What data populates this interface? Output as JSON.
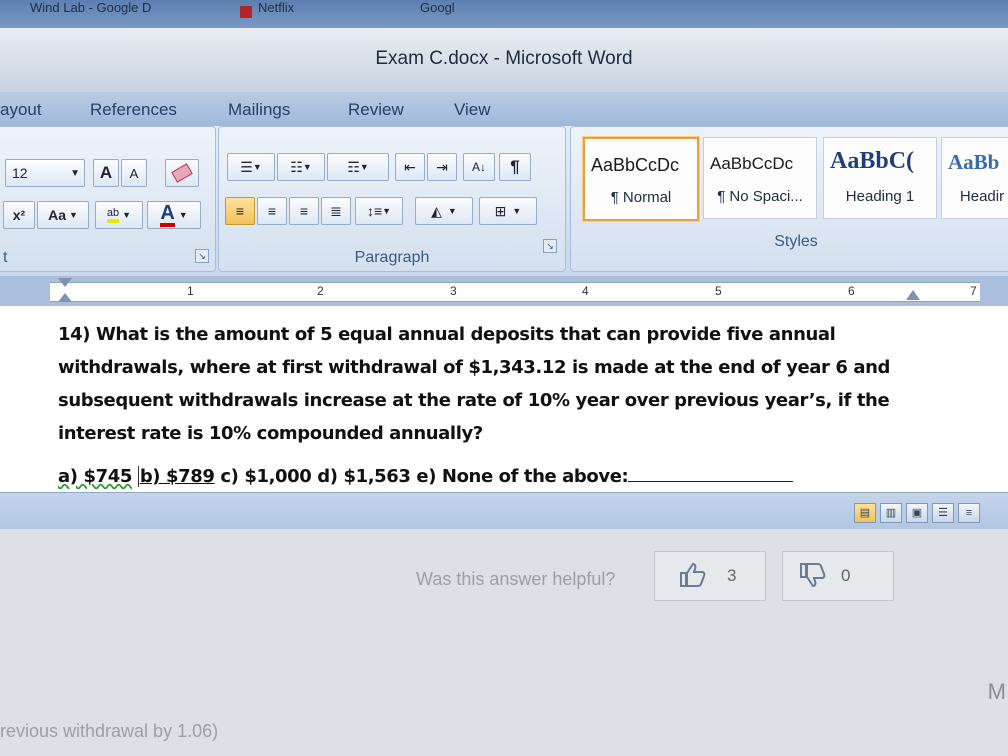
{
  "browser": {
    "tabs": [
      "Wind Lab - Google D",
      "Netflix",
      "Googl"
    ]
  },
  "window": {
    "title": "Exam C.docx - Microsoft Word"
  },
  "ribbon": {
    "tabs": [
      "ayout",
      "References",
      "Mailings",
      "Review",
      "View"
    ],
    "font": {
      "size": "12",
      "grow_label": "A",
      "shrink_label": "A",
      "change_case_label": "Aa",
      "superscript_label": "x²",
      "highlight_label": "ab",
      "font_color_label": "A",
      "group_label": "t"
    },
    "paragraph": {
      "group_label": "Paragraph"
    },
    "styles": {
      "group_label": "Styles",
      "items": [
        {
          "sample": "AaBbCcDc",
          "name": "¶ Normal",
          "selected": true
        },
        {
          "sample": "AaBbCcDc",
          "name": "¶ No Spaci...",
          "selected": false
        },
        {
          "sample": "AaBbC(",
          "name": "Heading 1",
          "selected": false
        },
        {
          "sample": "AaBb",
          "name": "Headir",
          "selected": false
        }
      ]
    }
  },
  "ruler": {
    "numbers": [
      "1",
      "2",
      "3",
      "4",
      "5",
      "6",
      "7"
    ]
  },
  "document": {
    "question": "14) What is the amount of 5 equal annual deposits that can provide five annual withdrawals, where at first withdrawal of $1,343.12 is made at the end of year 6 and subsequent withdrawals increase at the rate of 10% year over previous year’s, if the interest rate is 10% compounded annually?",
    "answers": {
      "a": "a) $745",
      "b": "b) $789",
      "c": "c) $1,000",
      "d": "d) $1,563",
      "e": "e) None of the above:"
    }
  },
  "feedback": {
    "prompt": "Was this answer helpful?",
    "likes": "3",
    "dislikes": "0"
  },
  "footer": {
    "text": "revious withdrawal by 1.06)",
    "corner_letter": "M"
  },
  "colors": {
    "ribbon_accent": "#2f5597",
    "selected_style_border": "#e9a23b",
    "font_color_underline": "#d00000"
  }
}
